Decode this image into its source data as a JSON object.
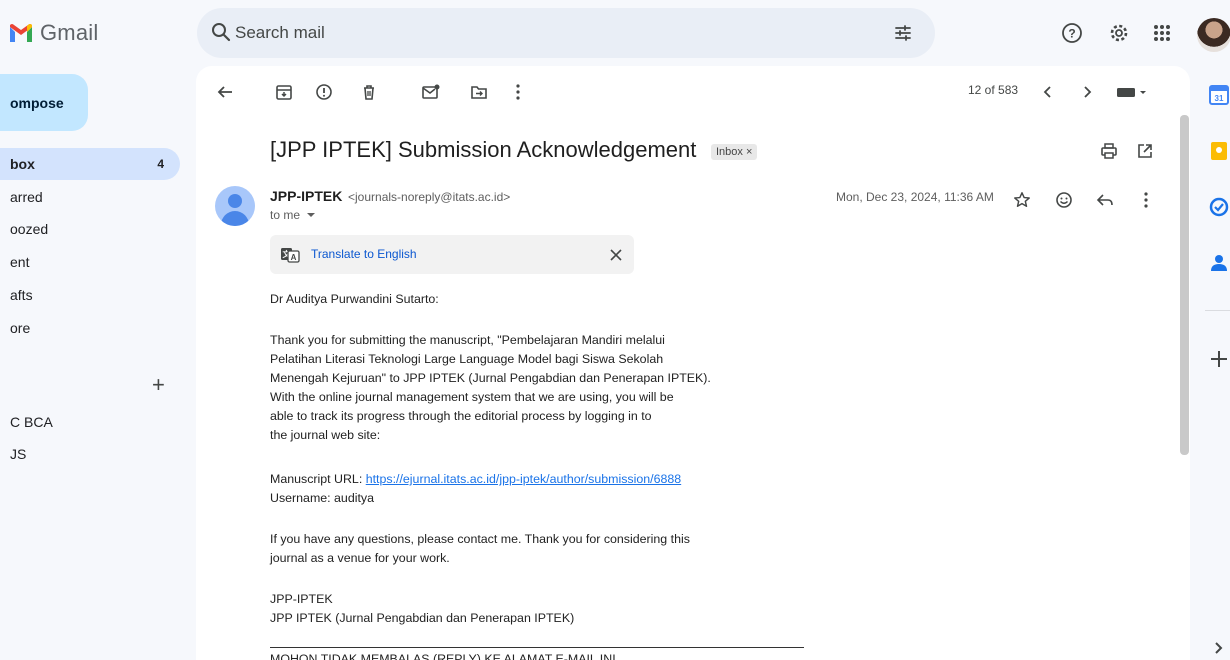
{
  "brand": {
    "logo_text": "Gmail"
  },
  "search": {
    "placeholder": "Search mail"
  },
  "sidebar": {
    "compose_label": "ompose",
    "items": [
      {
        "label": "box",
        "count": "4"
      },
      {
        "label": "arred"
      },
      {
        "label": "oozed"
      },
      {
        "label": "ent"
      },
      {
        "label": "afts"
      },
      {
        "label": "ore"
      }
    ],
    "labels": [
      "C BCA",
      "JS"
    ],
    "add_label_symbol": "+"
  },
  "toolbar": {
    "pager": "12 of 583"
  },
  "message": {
    "subject": "[JPP IPTEK] Submission Acknowledgement",
    "label_badge": "Inbox ×",
    "sender_name": "JPP-IPTEK",
    "sender_email": "<journals-noreply@itats.ac.id>",
    "recipient": "to me",
    "date": "Mon, Dec 23, 2024, 11:36 AM",
    "translate_label": "Translate to English",
    "greeting": "Dr Auditya Purwandini Sutarto:",
    "para1": [
      "Thank you for submitting the manuscript, \"Pembelajaran Mandiri melalui",
      "Pelatihan Literasi Teknologi Large Language Model bagi Siswa Sekolah",
      "Menengah Kejuruan\" to JPP IPTEK (Jurnal Pengabdian dan Penerapan IPTEK).",
      "With the online journal management system that we are using, you will be",
      "able to track its progress through the editorial process by logging in to",
      "the journal web site:"
    ],
    "url_label": "Manuscript URL: ",
    "url": "https://ejurnal.itats.ac.id/jpp-iptek/author/submission/6888",
    "username_line": "Username: auditya",
    "para2": [
      "If you have any questions, please contact me. Thank you for considering this",
      "journal as a venue for your work."
    ],
    "signature": [
      "JPP-IPTEK",
      "JPP IPTEK (Jurnal Pengabdian dan Penerapan IPTEK)"
    ],
    "footer_cut": "MOHON TIDAK MEMBALAS (REPLY) KE ALAMAT E-MAIL INI"
  },
  "colors": {
    "accent": "#0b57d0",
    "compose_bg": "#c2e7ff",
    "active_nav_bg": "#d3e3fd",
    "panel_bg": "#ffffff",
    "app_bg": "#f6f8fc"
  }
}
